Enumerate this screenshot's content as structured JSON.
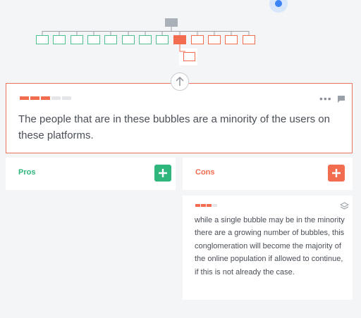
{
  "colors": {
    "accent_red": "#f26c4f",
    "accent_green": "#2eb67d",
    "tree_green": "#52c08f",
    "tree_red": "#f26c4f",
    "tree_gray": "#aab0b8"
  },
  "claim": {
    "text": "The people that are in these bubbles are a minority of the users on these platforms.",
    "strength_segments": [
      "red",
      "red",
      "red",
      "gray",
      "gray"
    ]
  },
  "pros": {
    "label": "Pros",
    "add_icon": "plus-icon"
  },
  "cons": {
    "label": "Cons",
    "add_icon": "plus-icon"
  },
  "argument": {
    "text": "while a single bubble may be in the minority there are a growing number of bubbles, this conglomeration will become the majority of the online population if allowed to continue, if this is not already the case.",
    "strength_segments": [
      "red",
      "red",
      "red",
      "gray"
    ]
  },
  "icons": {
    "up": "arrow-up-icon",
    "more": "more-dots-icon",
    "comment": "comment-icon",
    "layers": "layers-icon"
  }
}
